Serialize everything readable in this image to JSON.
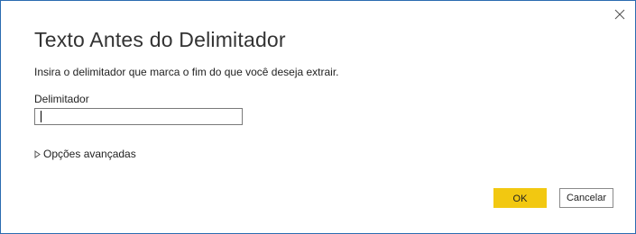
{
  "dialog": {
    "title": "Texto Antes do Delimitador",
    "description": "Insira o delimitador que marca o fim do que você deseja extrair.",
    "field_label": "Delimitador",
    "field_value": "",
    "advanced_label": "Opções avançadas",
    "ok_label": "OK",
    "cancel_label": "Cancelar"
  },
  "colors": {
    "accent": "#f2c811",
    "border": "#2b6cb0"
  },
  "icons": {
    "close": "close-icon",
    "expand": "triangle-right-icon"
  }
}
